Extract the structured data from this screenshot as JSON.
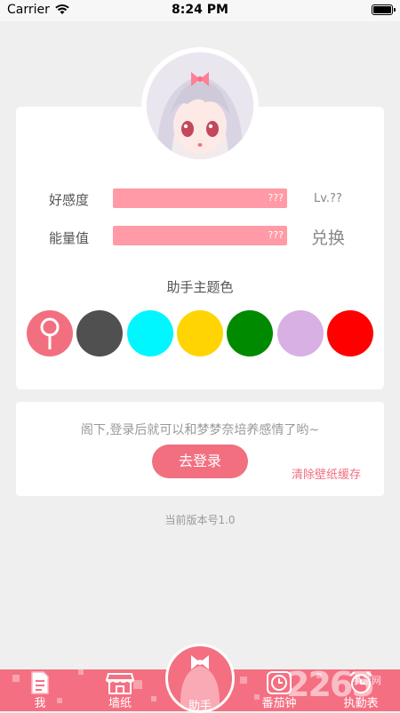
{
  "status_bar": {
    "carrier": "Carrier",
    "time": "8:24 PM"
  },
  "stats": {
    "favor": {
      "label": "好感度",
      "value_text": "???",
      "level": "Lv.??"
    },
    "energy": {
      "label": "能量值",
      "value_text": "???",
      "action": "兑换"
    }
  },
  "theme": {
    "title": "助手主题色",
    "colors": [
      "#f26f80",
      "#505050",
      "#00f7ff",
      "#ffd400",
      "#008a00",
      "#d8b0e4",
      "#ff0000"
    ],
    "selected_index": 0
  },
  "login": {
    "prompt": "阁下,登录后就可以和梦梦奈培养感情了哟~",
    "button": "去登录",
    "clear_cache": "清除壁纸缓存"
  },
  "version": "当前版本号1.0",
  "tabs": {
    "me": "我",
    "wallpaper": "墙纸",
    "assistant": "助手",
    "pomodoro": "番茄钟",
    "duty": "执勤表"
  },
  "watermark": {
    "brand": "2265",
    "sub": "手游网"
  }
}
